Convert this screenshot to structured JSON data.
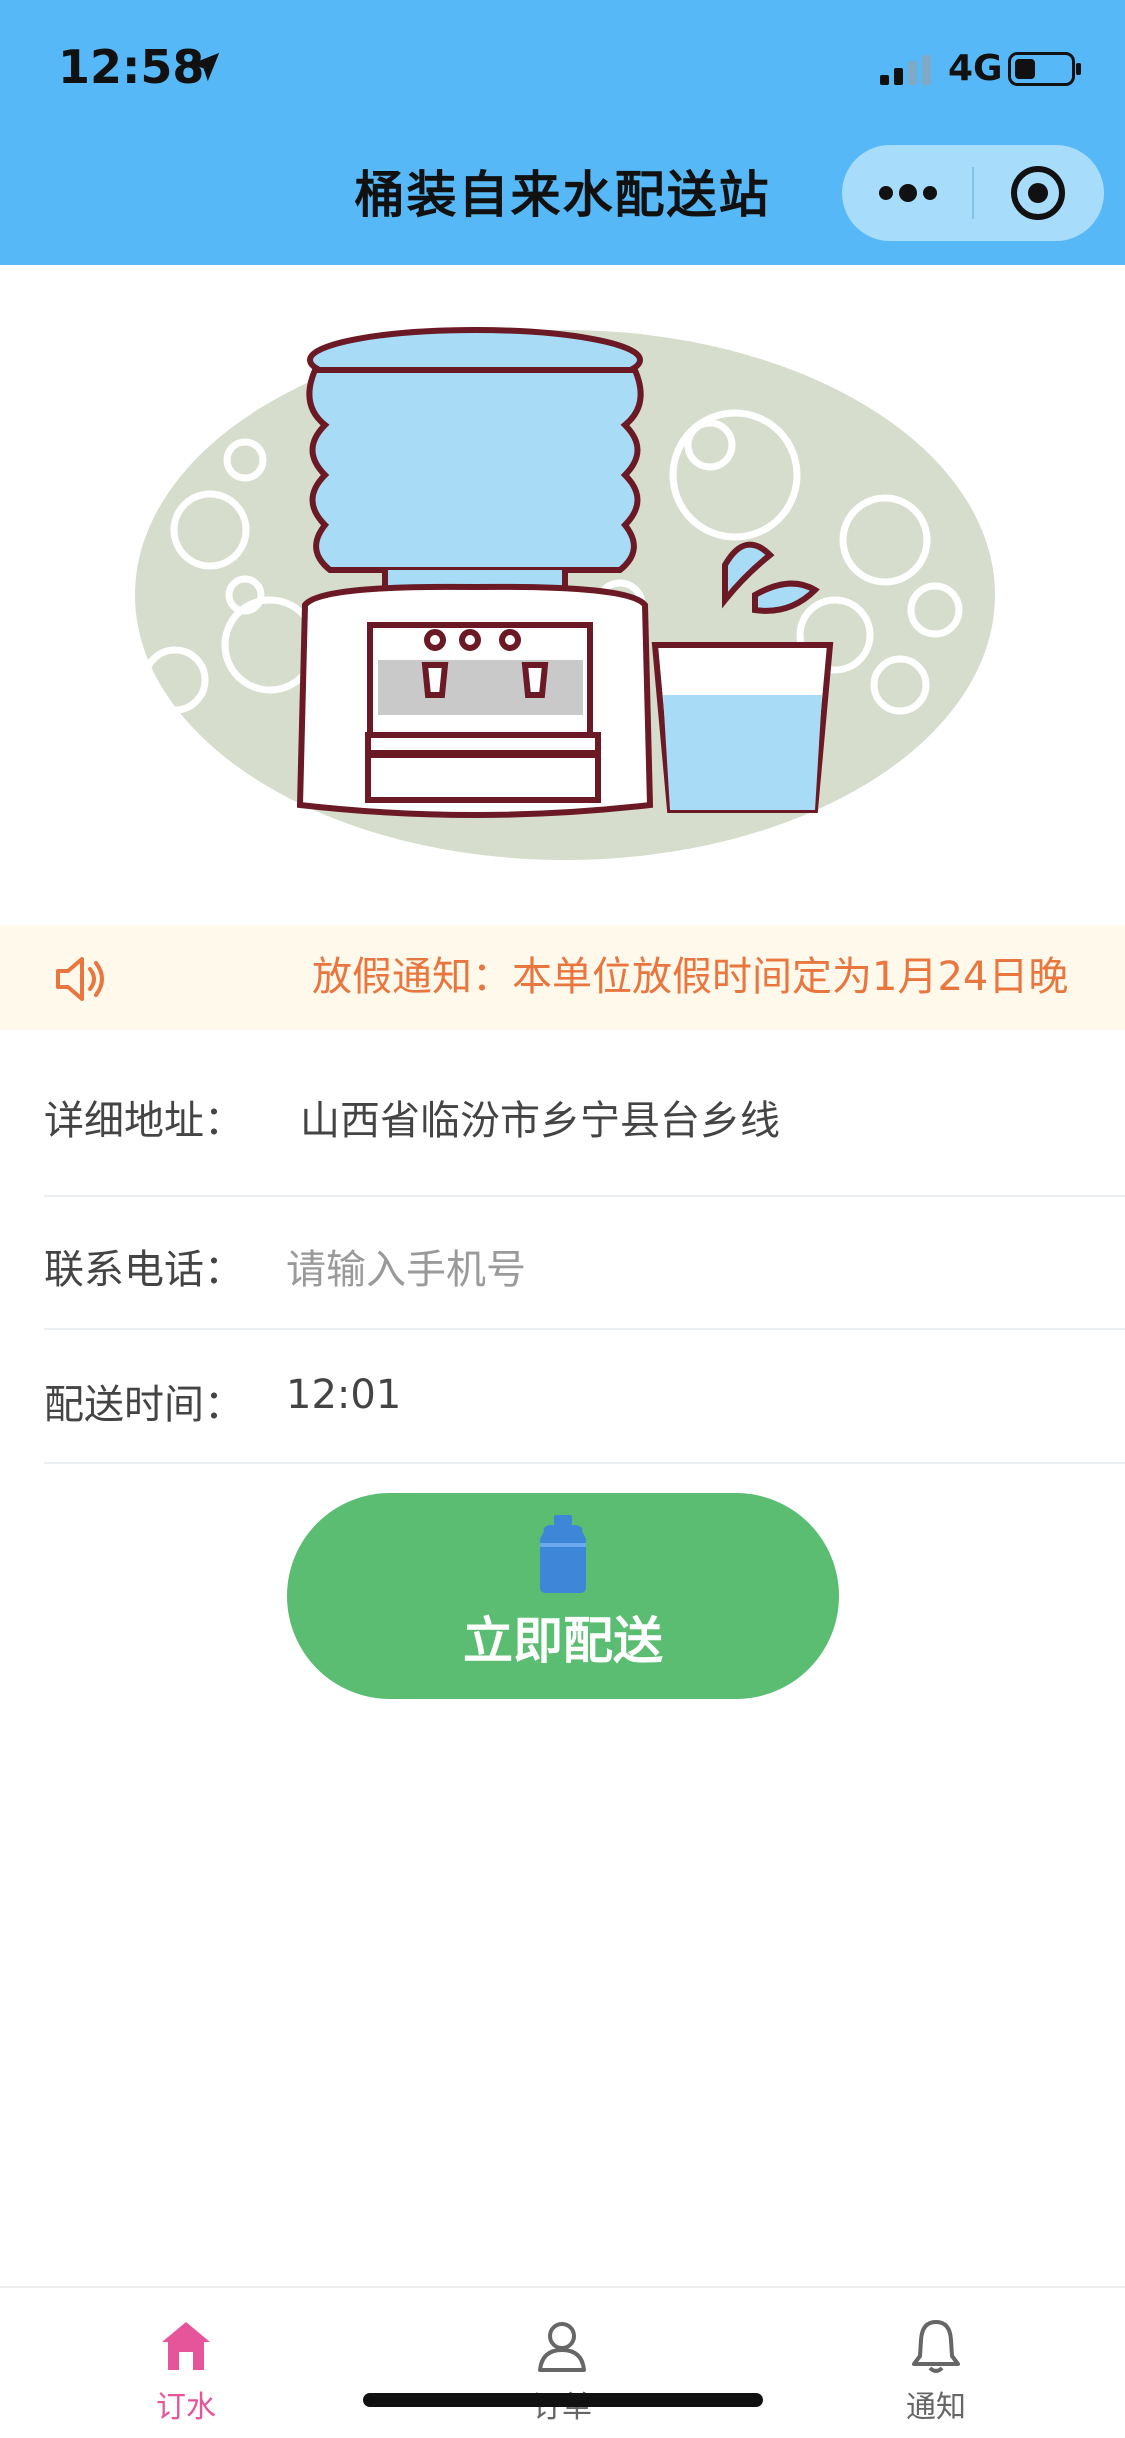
{
  "status_bar": {
    "time": "12:58",
    "network": "4G"
  },
  "nav": {
    "title": "桶装自来水配送站"
  },
  "notice": {
    "text": "放假通知：本单位放假时间定为1月24日晚"
  },
  "form": {
    "address": {
      "label": "详细地址：",
      "value": "山西省临汾市乡宁县台乡线"
    },
    "phone": {
      "label": "联系电话：",
      "placeholder": "请输入手机号"
    },
    "time": {
      "label": "配送时间：",
      "value": "12:01"
    }
  },
  "deliver_button": {
    "label": "立即配送"
  },
  "tabs": [
    {
      "label": "订水",
      "icon": "home-icon",
      "active": true
    },
    {
      "label": "订单",
      "icon": "user-icon",
      "active": false
    },
    {
      "label": "通知",
      "icon": "bell-icon",
      "active": false
    }
  ],
  "colors": {
    "header": "#56b8f6",
    "button": "#5bbd72",
    "notice_text": "#e9763f",
    "active_tab": "#e6559a"
  }
}
